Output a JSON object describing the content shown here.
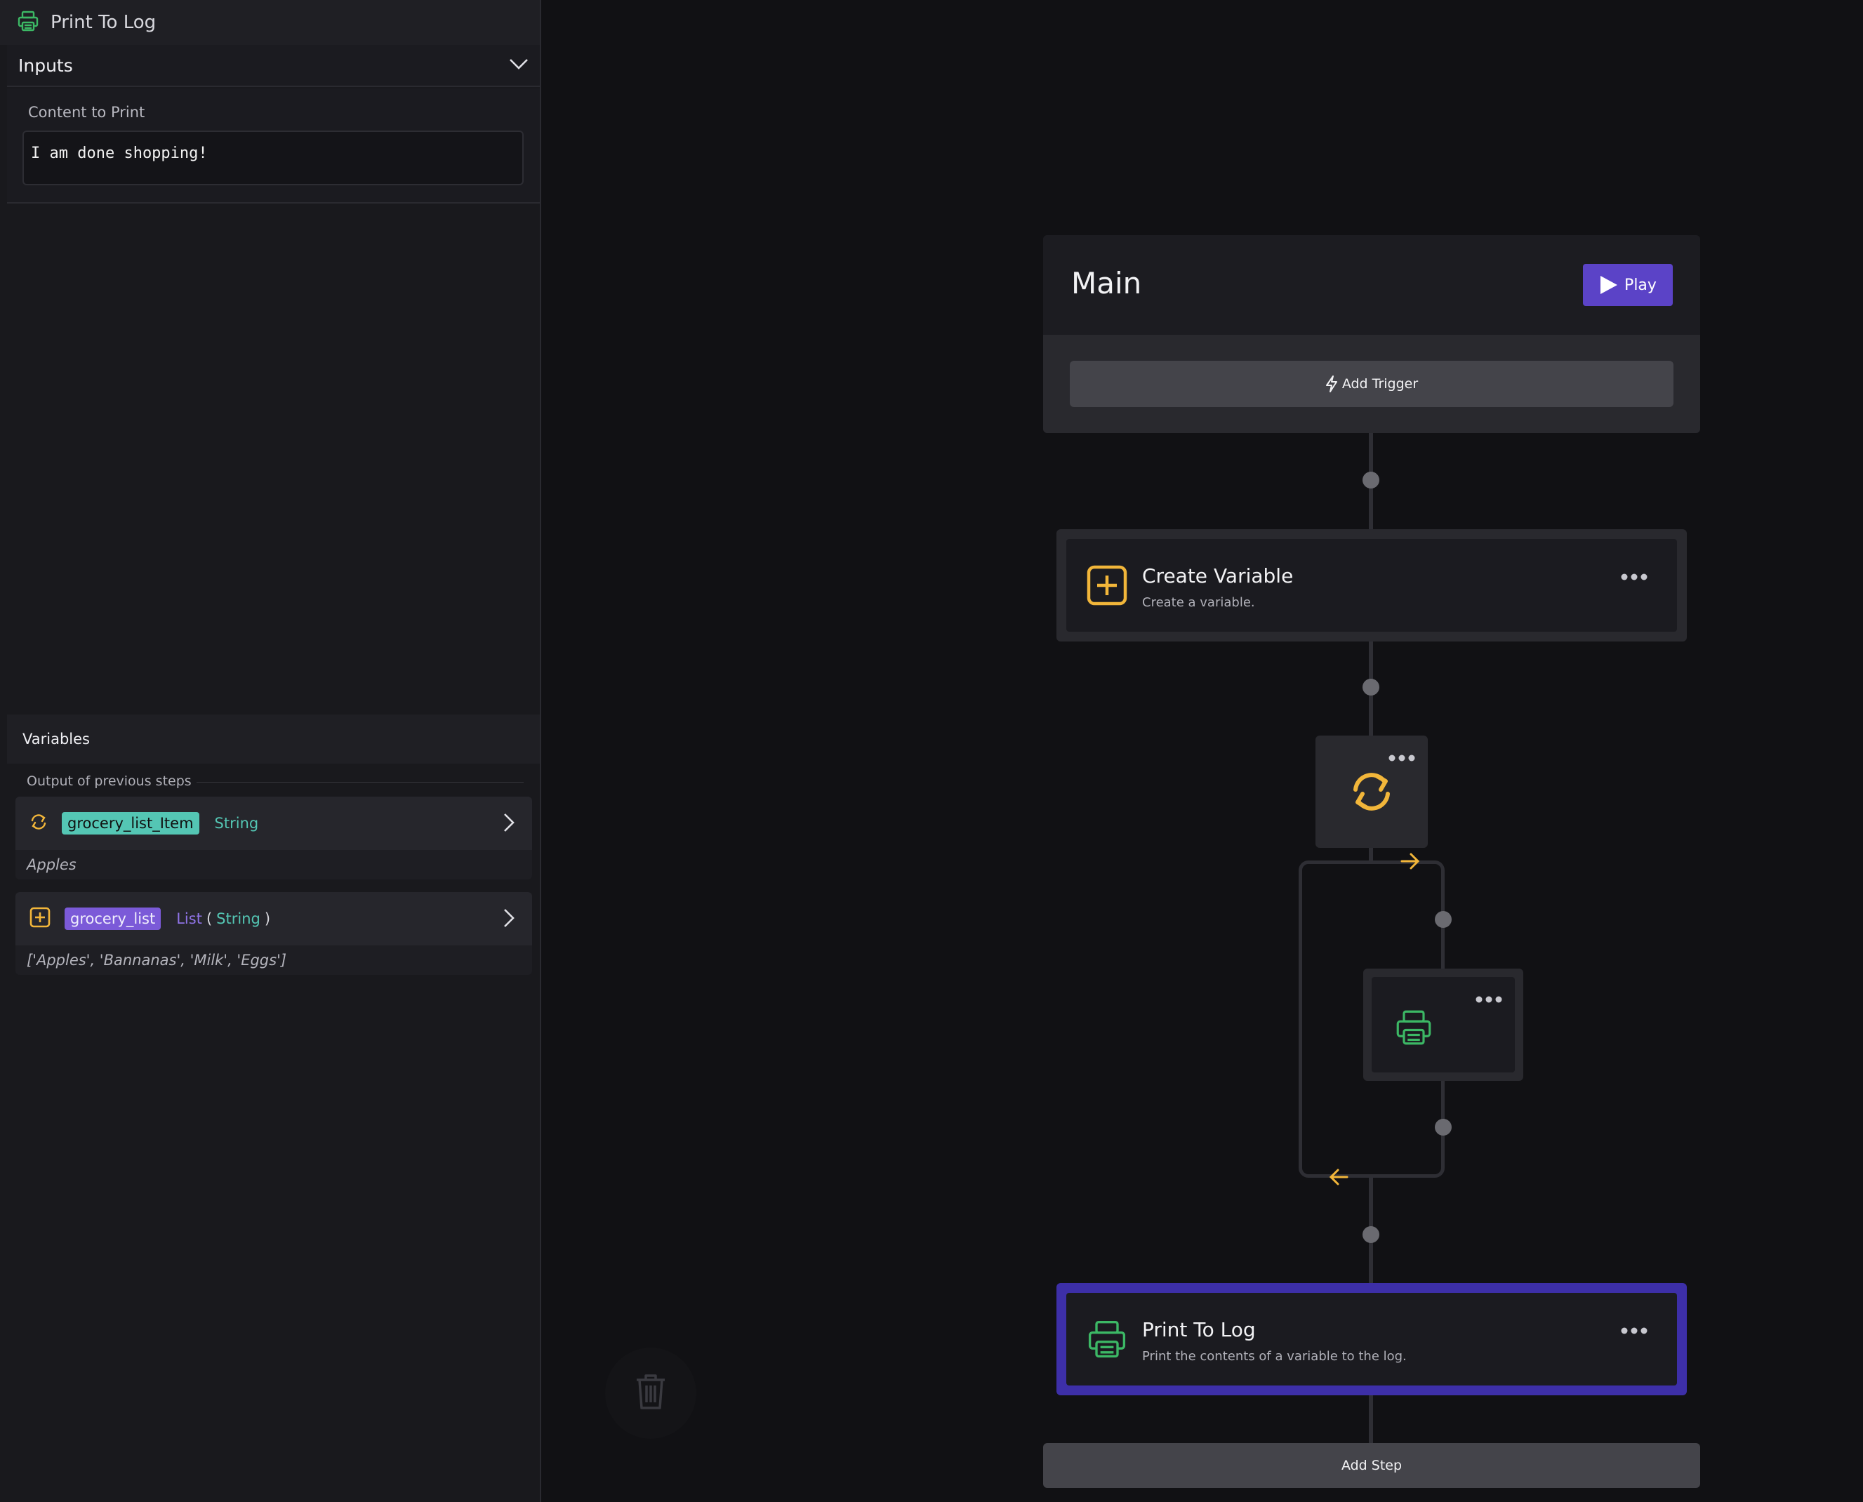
{
  "panel": {
    "title": "Print To Log",
    "inputs_label": "Inputs",
    "content_label": "Content to Print",
    "content_value": "I am done shopping!"
  },
  "variables": {
    "title": "Variables",
    "section_label": "Output of previous steps",
    "items": [
      {
        "name": "grocery_list_Item",
        "type": "String",
        "value": "Apples",
        "icon": "loop-icon"
      },
      {
        "name": "grocery_list",
        "type": "List",
        "subtype": "String",
        "value": "['Apples', 'Bannanas', 'Milk', 'Eggs']",
        "icon": "create-variable-icon"
      }
    ]
  },
  "flow": {
    "title": "Main",
    "play_label": "Play",
    "add_trigger_label": "Add Trigger",
    "steps": [
      {
        "title": "Create Variable",
        "description": "Create a variable."
      },
      {
        "title": "Print To Log",
        "description": "Print the contents of a variable to the log."
      }
    ],
    "add_step_label": "Add Step"
  },
  "colors": {
    "accent_purple": "#5b43c7",
    "selection_border": "#3d2fa8",
    "icon_yellow": "#f2b63a",
    "icon_green": "#3cb865",
    "tag_teal": "#54c6b4",
    "tag_purple": "#7b5ad8"
  }
}
